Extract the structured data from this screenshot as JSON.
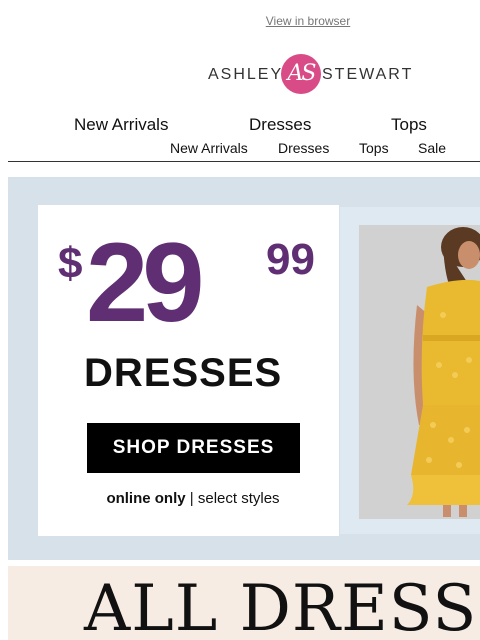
{
  "header": {
    "view_in_browser": "View in browser",
    "brand_left": "ASHLEY",
    "brand_monogram": "AS",
    "brand_right": "STEWART"
  },
  "nav_primary": [
    {
      "label": "New Arrivals"
    },
    {
      "label": "Dresses"
    },
    {
      "label": "Tops"
    }
  ],
  "nav_secondary": [
    {
      "label": "New Arrivals"
    },
    {
      "label": "Dresses"
    },
    {
      "label": "Tops"
    },
    {
      "label": "Sale"
    }
  ],
  "hero": {
    "currency": "$",
    "price_whole": "29",
    "price_cents": "99",
    "category": "DRESSES",
    "cta_label": "SHOP DRESSES",
    "note_bold": "online only",
    "note_rest": "| select styles"
  },
  "banner": {
    "headline": "ALL DRESSED U"
  },
  "colors": {
    "brand_pink": "#d94b86",
    "price_purple": "#5f2e73",
    "hero_bg": "#d6e1ea",
    "banner_bg": "#f7ece4"
  }
}
